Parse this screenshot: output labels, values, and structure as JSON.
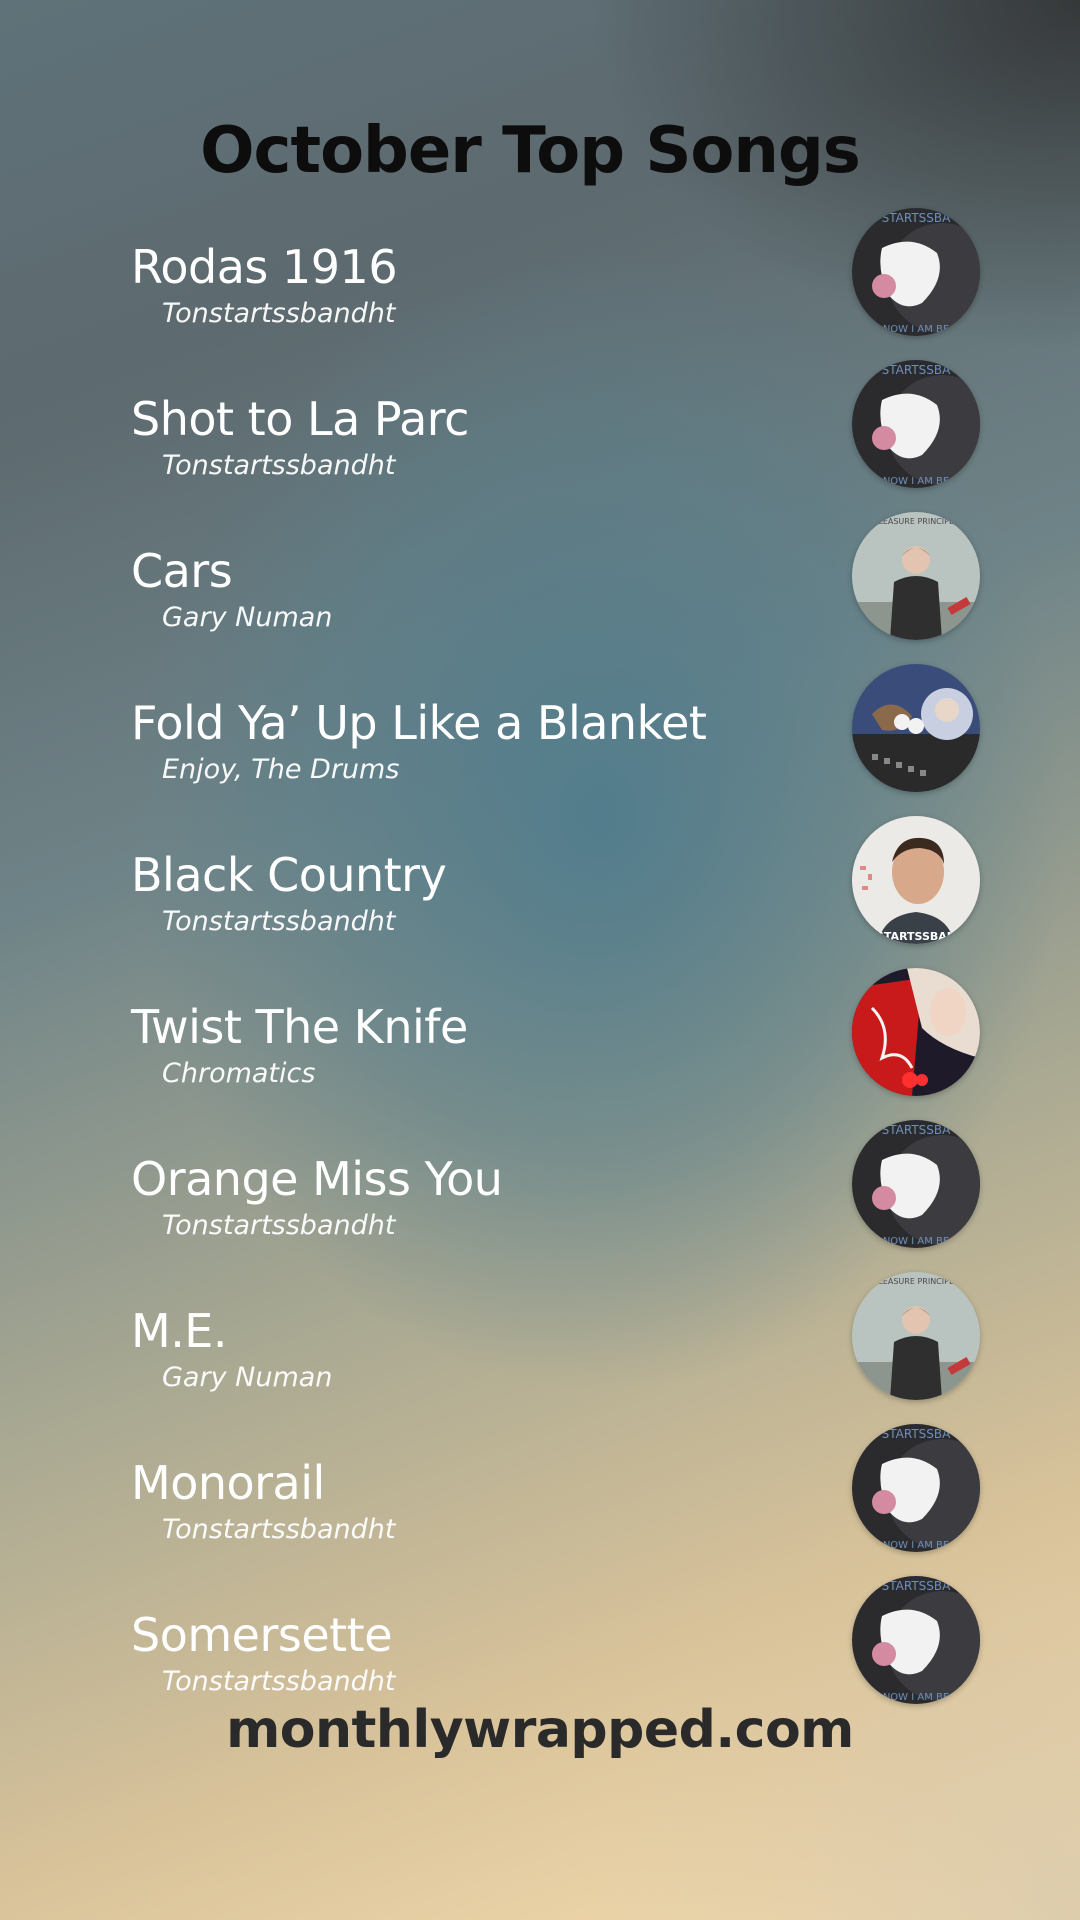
{
  "header": {
    "title": "October Top Songs"
  },
  "songs": [
    {
      "title": "Rodas 1916",
      "artist": "Tonstartssbandht",
      "cover_icon": "mask-cover-icon"
    },
    {
      "title": "Shot to La Parc",
      "artist": "Tonstartssbandht",
      "cover_icon": "mask-cover-icon"
    },
    {
      "title": "Cars",
      "artist": "Gary Numan",
      "cover_icon": "pleasure-principle-cover-icon"
    },
    {
      "title": "Fold Ya’ Up Like a Blanket",
      "artist": "Enjoy, The Drums",
      "cover_icon": "collage-cover-icon"
    },
    {
      "title": "Black Country",
      "artist": "Tonstartssbandht",
      "cover_icon": "portrait-cover-icon"
    },
    {
      "title": "Twist The Knife",
      "artist": "Chromatics",
      "cover_icon": "red-collage-cover-icon"
    },
    {
      "title": "Orange Miss You",
      "artist": "Tonstartssbandht",
      "cover_icon": "mask-cover-icon"
    },
    {
      "title": "M.E.",
      "artist": "Gary Numan",
      "cover_icon": "pleasure-principle-cover-icon"
    },
    {
      "title": "Monorail",
      "artist": "Tonstartssbandht",
      "cover_icon": "mask-cover-icon"
    },
    {
      "title": "Somersette",
      "artist": "Tonstartssbandht",
      "cover_icon": "mask-cover-icon"
    }
  ],
  "cover_text": {
    "mask_top": "STARTSSBA",
    "mask_bottom": "NOW I AM BE",
    "pleasure_top": "PLEASURE PRINCIPLE",
    "portrait_bottom": "STARTSSBAN"
  },
  "footer": {
    "site": "monthlywrapped.com"
  },
  "colors": {
    "title": "#0d0d0d",
    "song_text": "#ffffff",
    "footer": "#2a2a2a"
  }
}
